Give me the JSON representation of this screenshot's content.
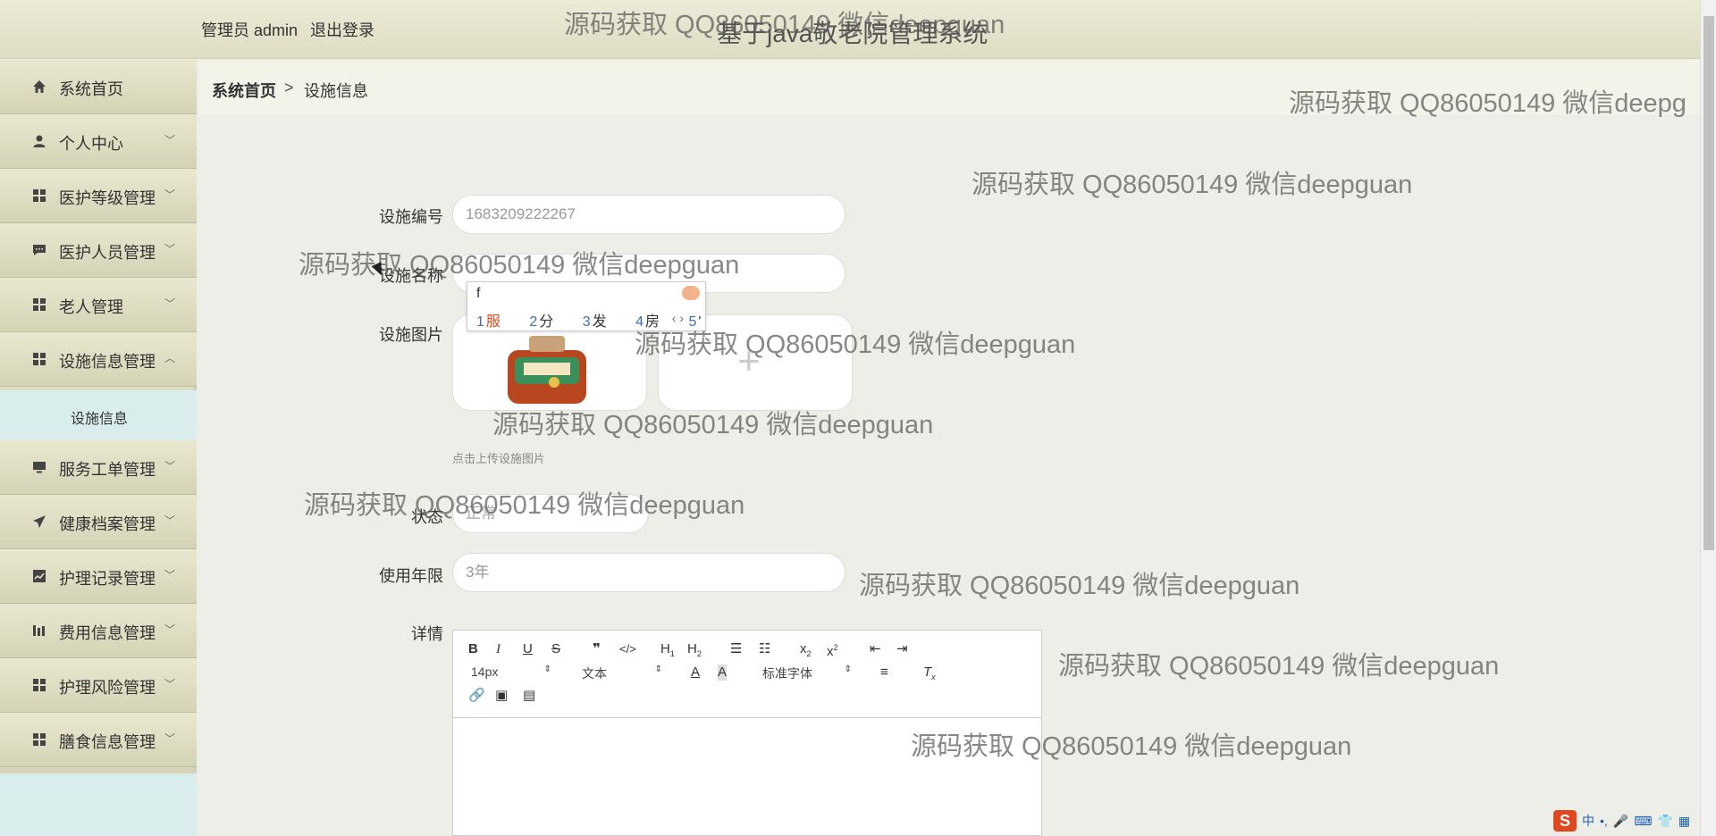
{
  "header": {
    "user": "管理员 admin",
    "logout": "退出登录",
    "system_title": "基于java敬老院管理系统"
  },
  "sidebar": {
    "items": [
      {
        "label": "系统首页",
        "icon": "home-icon"
      },
      {
        "label": "个人中心",
        "icon": "user-icon"
      },
      {
        "label": "医护等级管理",
        "icon": "grid-icon"
      },
      {
        "label": "医护人员管理",
        "icon": "chat-icon"
      },
      {
        "label": "老人管理",
        "icon": "grid-icon"
      },
      {
        "label": "设施信息管理",
        "icon": "grid-icon"
      },
      {
        "label": "服务工单管理",
        "icon": "monitor-icon"
      },
      {
        "label": "健康档案管理",
        "icon": "send-icon"
      },
      {
        "label": "护理记录管理",
        "icon": "chart-icon"
      },
      {
        "label": "费用信息管理",
        "icon": "bars-icon"
      },
      {
        "label": "护理风险管理",
        "icon": "grid-icon"
      },
      {
        "label": "膳食信息管理",
        "icon": "grid-icon"
      }
    ],
    "submenu": "设施信息"
  },
  "breadcrumb": {
    "home": "系统首页",
    "separator": ">",
    "current": "设施信息"
  },
  "form": {
    "code_label": "设施编号",
    "code_value": "1683209222267",
    "name_label": "设施名称",
    "name_value": "",
    "image_label": "设施图片",
    "upload_hint": "点击上传设施图片",
    "status_label": "状态",
    "status_value": "正常",
    "years_label": "使用年限",
    "years_value": "3年",
    "detail_label": "详情"
  },
  "ime": {
    "composition": "f",
    "candidates": [
      {
        "num": "1",
        "text": "服"
      },
      {
        "num": "2",
        "text": "分"
      },
      {
        "num": "3",
        "text": "发"
      },
      {
        "num": "4",
        "text": "房"
      },
      {
        "num": "5",
        "text": "'"
      }
    ],
    "nav": "‹ ›"
  },
  "editor": {
    "font_size": "14px",
    "block_type": "文本",
    "font_family": "标准字体"
  },
  "watermark": "源码获取 QQ86050149 微信deepguan",
  "watermark_cut": "源码获取 QQ86050149 微信deepg",
  "tray": [
    "中",
    "•,",
    "🎤",
    "⌨",
    "👕",
    "▦"
  ]
}
